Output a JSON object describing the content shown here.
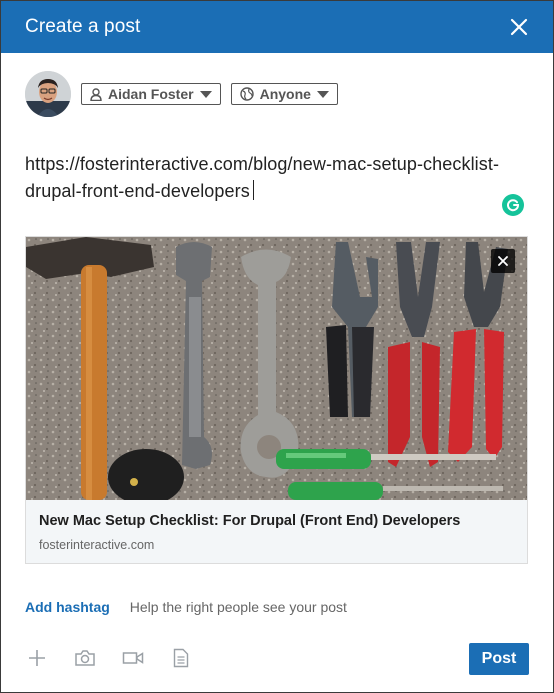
{
  "header": {
    "title": "Create a post",
    "close_icon": "close-icon"
  },
  "author": {
    "avatar_icon": "avatar",
    "name_chip": {
      "icon": "person-icon",
      "label": "Aidan Foster"
    },
    "visibility_chip": {
      "icon": "globe-icon",
      "label": "Anyone"
    }
  },
  "post": {
    "text_line1": "https://fosterinteractive.com/blog/new-mac-setup-checklist-",
    "text_line2": "drupal-front-end-developers"
  },
  "link_preview": {
    "image_icon": "tools-photo",
    "title": "New Mac Setup Checklist: For Drupal (Front End) Developers",
    "domain": "fosterinteractive.com"
  },
  "hashtag": {
    "add_label": "Add hashtag",
    "help_text": "Help the right people see your post"
  },
  "toolbar": {
    "icons": [
      "plus-icon",
      "camera-icon",
      "video-icon",
      "document-icon"
    ],
    "post_label": "Post"
  },
  "colors": {
    "brand": "#1b6eb5",
    "grammarly": "#15c39a",
    "preview_bg": "#f3f6f8"
  }
}
